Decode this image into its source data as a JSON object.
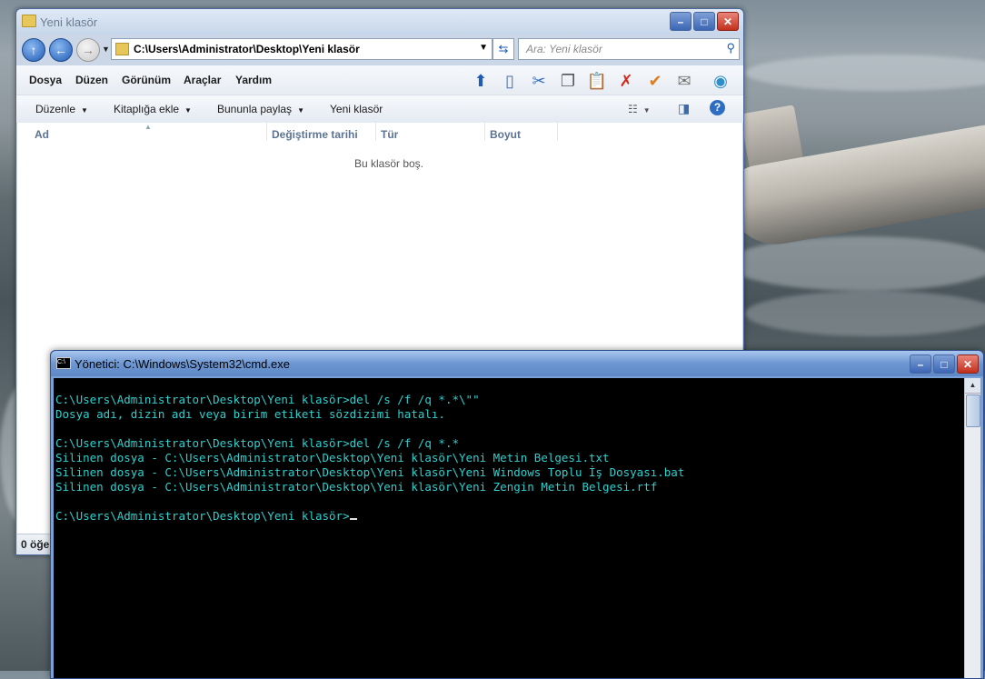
{
  "explorer": {
    "title": "Yeni klasör",
    "address": "C:\\Users\\Administrator\\Desktop\\Yeni klasör",
    "search_placeholder": "Ara: Yeni klasör",
    "menu": [
      "Dosya",
      "Düzen",
      "Görünüm",
      "Araçlar",
      "Yardım"
    ],
    "commands": [
      "Düzenle",
      "Kitaplığa ekle",
      "Bununla paylaş",
      "Yeni klasör"
    ],
    "columns": [
      "Ad",
      "Değiştirme tarihi",
      "Tür",
      "Boyut"
    ],
    "empty_message": "Bu klasör boş.",
    "status": "0 öğe"
  },
  "cmd": {
    "title": "Yönetici: C:\\Windows\\System32\\cmd.exe",
    "lines": [
      "C:\\Users\\Administrator\\Desktop\\Yeni klasör>del /s /f /q *.*\\\"\"",
      "Dosya adı, dizin adı veya birim etiketi sözdizimi hatalı.",
      "",
      "C:\\Users\\Administrator\\Desktop\\Yeni klasör>del /s /f /q *.*",
      "Silinen dosya - C:\\Users\\Administrator\\Desktop\\Yeni klasör\\Yeni Metin Belgesi.txt",
      "Silinen dosya - C:\\Users\\Administrator\\Desktop\\Yeni klasör\\Yeni Windows Toplu İş Dosyası.bat",
      "Silinen dosya - C:\\Users\\Administrator\\Desktop\\Yeni klasör\\Yeni Zengin Metin Belgesi.rtf",
      "",
      "C:\\Users\\Administrator\\Desktop\\Yeni klasör>"
    ]
  },
  "colors": {
    "cmd_text": "#2fd0d0",
    "cmd_bg": "#000000"
  }
}
